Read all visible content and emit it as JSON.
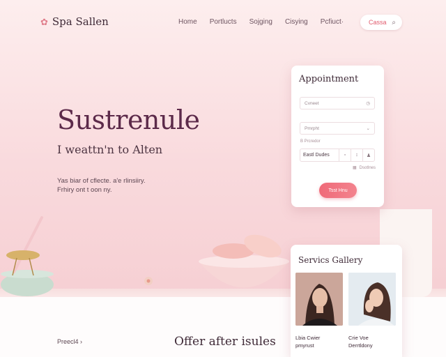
{
  "brand": {
    "name": "Spa Sallen",
    "icon": "flower-icon"
  },
  "nav": {
    "items": [
      "Home",
      "Portlucts",
      "Sojging",
      "Cisying",
      "Pcfiuct·"
    ]
  },
  "header_button": {
    "label": "Cassa",
    "icon": "search-icon"
  },
  "hero": {
    "title": "Sustrenule",
    "subtitle": "I weattn'n to Alten",
    "description_line1": "Yas biar of cflecte. a'e rlinsiiry.",
    "description_line2": "Frhiry ont t oon ny."
  },
  "appointment": {
    "title": "Appointment",
    "field1_placeholder": "Cvneet",
    "field2_placeholder": "Pmrpht",
    "small_label": "B Prcredor",
    "segment_main": "Eastl Dudes",
    "note": "Dsotlnes",
    "button_label": "Tsst Hnu"
  },
  "gallery": {
    "title": "Servics Gallery",
    "items": [
      {
        "caption_line1": "Lbia Cwier",
        "caption_line2": "pmyrust"
      },
      {
        "caption_line1": "Crie Voe",
        "caption_line2": "Derrtldony"
      }
    ]
  },
  "footer": {
    "left_text": "Preecl4 ›",
    "center_title": "Offer after isules"
  },
  "colors": {
    "accent": "#ef6a78",
    "brand_text": "#5c2a4a",
    "background": "#f9dadd"
  }
}
